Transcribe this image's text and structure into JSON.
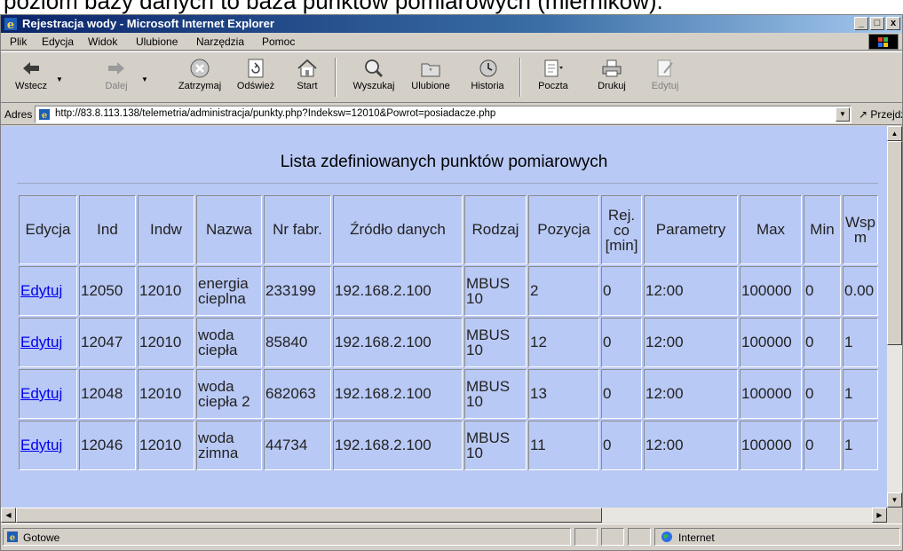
{
  "document_caption": "poziom bazy danych to baza punktów pomiarowych (mierników).",
  "window": {
    "title": "Rejestracja wody - Microsoft Internet Explorer",
    "minimize_glyph": "_",
    "maximize_glyph": "□",
    "close_glyph": "x"
  },
  "menu": [
    "Plik",
    "Edycja",
    "Widok",
    "Ulubione",
    "Narzędzia",
    "Pomoc"
  ],
  "toolbar": {
    "back": "Wstecz",
    "forward": "Dalej",
    "stop": "Zatrzymaj",
    "refresh": "Odśwież",
    "home": "Start",
    "search": "Wyszukaj",
    "favorites": "Ulubione",
    "history": "Historia",
    "mail": "Poczta",
    "print": "Drukuj",
    "edit": "Edytuj"
  },
  "address": {
    "label": "Adres",
    "url": "http://83.8.113.138/telemetria/administracja/punkty.php?Indeksw=12010&Powrot=posiadacze.php",
    "go": "Przejdź"
  },
  "page": {
    "title": "Lista zdefiniowanych punktów pomiarowych"
  },
  "table": {
    "headers": [
      "Edycja",
      "Ind",
      "Indw",
      "Nazwa",
      "Nr fabr.",
      "Źródło danych",
      "Rodzaj",
      "Pozycja",
      "Rej. co [min]",
      "Parametry",
      "Max",
      "Min",
      "Wsp m"
    ],
    "rows": [
      [
        "Edytuj",
        "12050",
        "12010",
        "energia cieplna",
        "233199",
        "192.168.2.100",
        "MBUS 10",
        "2",
        "0",
        "12:00",
        "100000",
        "0",
        "0.00"
      ],
      [
        "Edytuj",
        "12047",
        "12010",
        "woda ciepła",
        "85840",
        "192.168.2.100",
        "MBUS 10",
        "12",
        "0",
        "12:00",
        "100000",
        "0",
        "1"
      ],
      [
        "Edytuj",
        "12048",
        "12010",
        "woda ciepła 2",
        "682063",
        "192.168.2.100",
        "MBUS 10",
        "13",
        "0",
        "12:00",
        "100000",
        "0",
        "1"
      ],
      [
        "Edytuj",
        "12046",
        "12010",
        "woda zimna",
        "44734",
        "192.168.2.100",
        "MBUS 10",
        "11",
        "0",
        "12:00",
        "100000",
        "0",
        "1"
      ]
    ]
  },
  "status": {
    "text": "Gotowe",
    "zone": "Internet"
  },
  "colors": {
    "content_background": "#b9c9f5",
    "link": "#0000ee",
    "title_bar_start": "#0a246a"
  }
}
